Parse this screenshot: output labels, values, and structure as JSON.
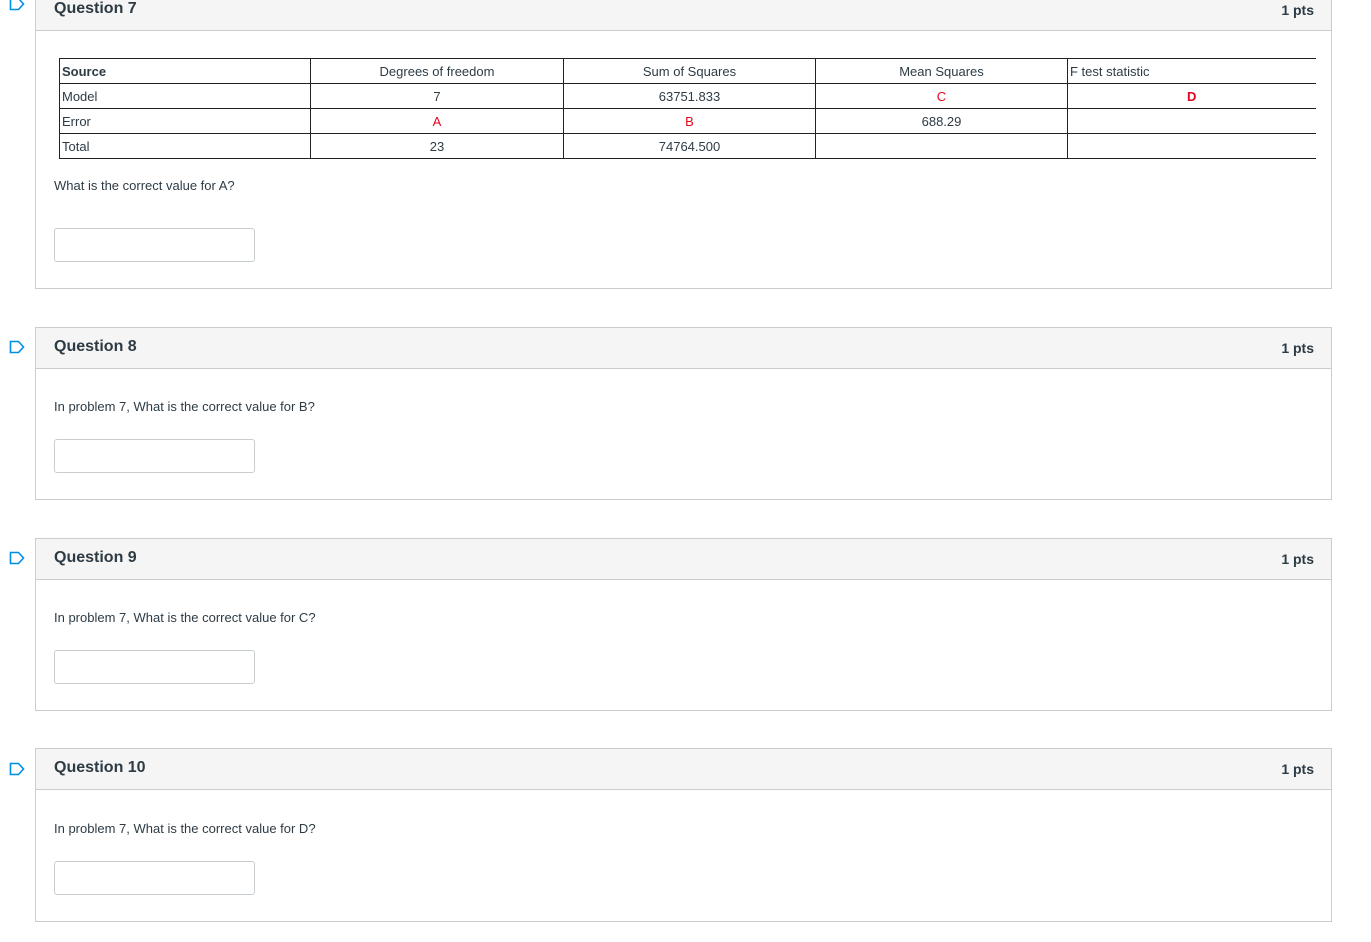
{
  "colors": {
    "accent": "#008ee2",
    "placeholder_red": "#e0061f",
    "header_bg": "#f5f5f5",
    "border": "#c7cdd1"
  },
  "questions": [
    {
      "title": "Question 7",
      "points": "1 pts",
      "text": "What is the correct value for A?",
      "answer_value": "",
      "table": {
        "headers": [
          "Source",
          "Degrees of freedom",
          "Sum of Squares",
          "Mean Squares",
          "F test statistic"
        ],
        "rows": [
          [
            "Model",
            "7",
            "63751.833",
            "C",
            "D"
          ],
          [
            "Error",
            "A",
            "B",
            "688.29",
            ""
          ],
          [
            "Total",
            "23",
            "74764.500",
            "",
            ""
          ]
        ]
      }
    },
    {
      "title": "Question 8",
      "points": "1 pts",
      "text": "In problem 7, What is the correct value for B?",
      "answer_value": ""
    },
    {
      "title": "Question 9",
      "points": "1 pts",
      "text": "In problem 7, What is the correct value for C?",
      "answer_value": ""
    },
    {
      "title": "Question 10",
      "points": "1 pts",
      "text": "In problem 7, What is the correct value for D?",
      "answer_value": ""
    }
  ],
  "icons": {
    "flag": "bookmark-flag-icon"
  }
}
